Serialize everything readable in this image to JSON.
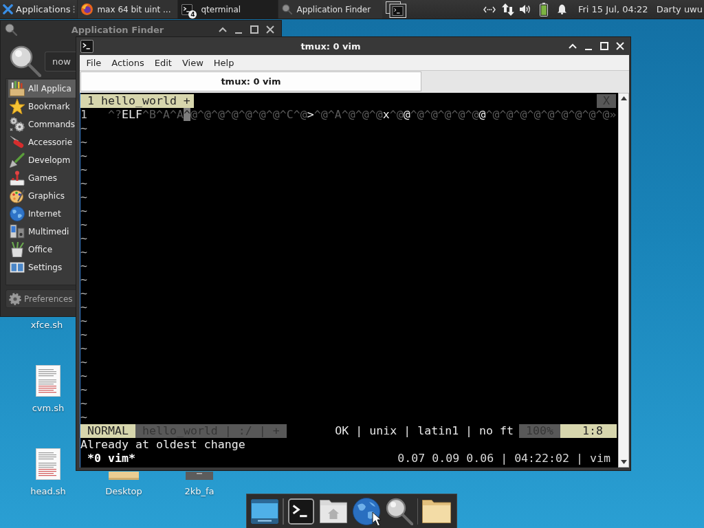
{
  "panel": {
    "menu_label": "Applications",
    "tasks": [
      {
        "label": "max 64 bit uint ...",
        "kind": "browser",
        "selected": false
      },
      {
        "label": "qterminal",
        "kind": "terminal",
        "badge": "4",
        "selected": true
      },
      {
        "label": "Application Finder",
        "kind": "finder",
        "selected": false
      }
    ],
    "clock": "Fri 15 Jul, 04:22",
    "user": "Darty uwu"
  },
  "app_finder": {
    "title": "Application Finder",
    "search": {
      "value": "now"
    },
    "categories": [
      {
        "label": "All Applica",
        "kind": "all",
        "selected": true
      },
      {
        "label": "Bookmark",
        "kind": "bookmarks",
        "selected": false
      },
      {
        "label": "Commands",
        "kind": "commands",
        "selected": false
      },
      {
        "label": "Accessorie",
        "kind": "accessories",
        "selected": false
      },
      {
        "label": "Developm",
        "kind": "development",
        "selected": false
      },
      {
        "label": "Games",
        "kind": "games",
        "selected": false
      },
      {
        "label": "Graphics",
        "kind": "graphics",
        "selected": false
      },
      {
        "label": "Internet",
        "kind": "internet",
        "selected": false
      },
      {
        "label": "Multimedi",
        "kind": "multimedia",
        "selected": false
      },
      {
        "label": "Office",
        "kind": "office",
        "selected": false
      },
      {
        "label": "Settings",
        "kind": "settings",
        "selected": false
      }
    ],
    "preferences": "Preferences"
  },
  "terminal": {
    "title": "tmux: 0 vim",
    "menu": [
      "File",
      "Actions",
      "Edit",
      "View",
      "Help"
    ],
    "tabs": [
      {
        "label": "tmux: 0 vim",
        "selected": true
      }
    ],
    "vim": {
      "tabline": {
        "label": "1 hello_world +",
        "close": "X"
      },
      "lines": [
        {
          "number": "1",
          "segments": [
            {
              "text": "^?",
              "kind": "special"
            },
            {
              "text": "ELF",
              "kind": "normal"
            },
            {
              "text": "^B^A^A",
              "kind": "special"
            },
            {
              "text": "^",
              "kind": "cursor"
            },
            {
              "text": "@^@^@^@^@^@^@^C^@",
              "kind": "special"
            },
            {
              "text": ">",
              "kind": "normal"
            },
            {
              "text": "^@^A^@^@^@",
              "kind": "special"
            },
            {
              "text": "x",
              "kind": "normal"
            },
            {
              "text": "^@",
              "kind": "special"
            },
            {
              "text": "@",
              "kind": "normal"
            },
            {
              "text": "^@^@^@^@^@",
              "kind": "special"
            },
            {
              "text": "@",
              "kind": "normal"
            },
            {
              "text": "^@^@^@^@^@^@^@^@^@",
              "kind": "special"
            },
            {
              "text": "»",
              "kind": "special"
            }
          ]
        }
      ],
      "empty_lines": [
        "~",
        "~",
        "~",
        "~",
        "~",
        "~",
        "~",
        "~",
        "~",
        "~",
        "~",
        "~",
        "~",
        "~",
        "~",
        "~",
        "~",
        "~",
        "~",
        "~",
        "~",
        "~"
      ],
      "statusline": {
        "mode": "NORMAL",
        "file": "hello_world | :/ | +",
        "info": "OK | unix | latin1 | no ft",
        "percent": "100%",
        "position": "1:8"
      },
      "message": "Already at oldest change"
    },
    "tmux_status": {
      "left": "*0 vim*",
      "right": "0.07 0.09 0.06 | 04:22:02 | vim"
    }
  },
  "desktop_icons": [
    {
      "label": "xfce.sh",
      "kind": "label"
    },
    {
      "label": "cvm.sh",
      "kind": "document"
    },
    {
      "label": "head.sh",
      "kind": "document"
    },
    {
      "label": "Desktop",
      "kind": "folder"
    },
    {
      "label": "2kb_fa",
      "kind": "file"
    }
  ],
  "dock": [
    {
      "kind": "desktop"
    },
    {
      "kind": "separator"
    },
    {
      "kind": "terminal"
    },
    {
      "kind": "home"
    },
    {
      "kind": "browser"
    },
    {
      "kind": "search"
    },
    {
      "kind": "separator"
    },
    {
      "kind": "folder"
    }
  ]
}
